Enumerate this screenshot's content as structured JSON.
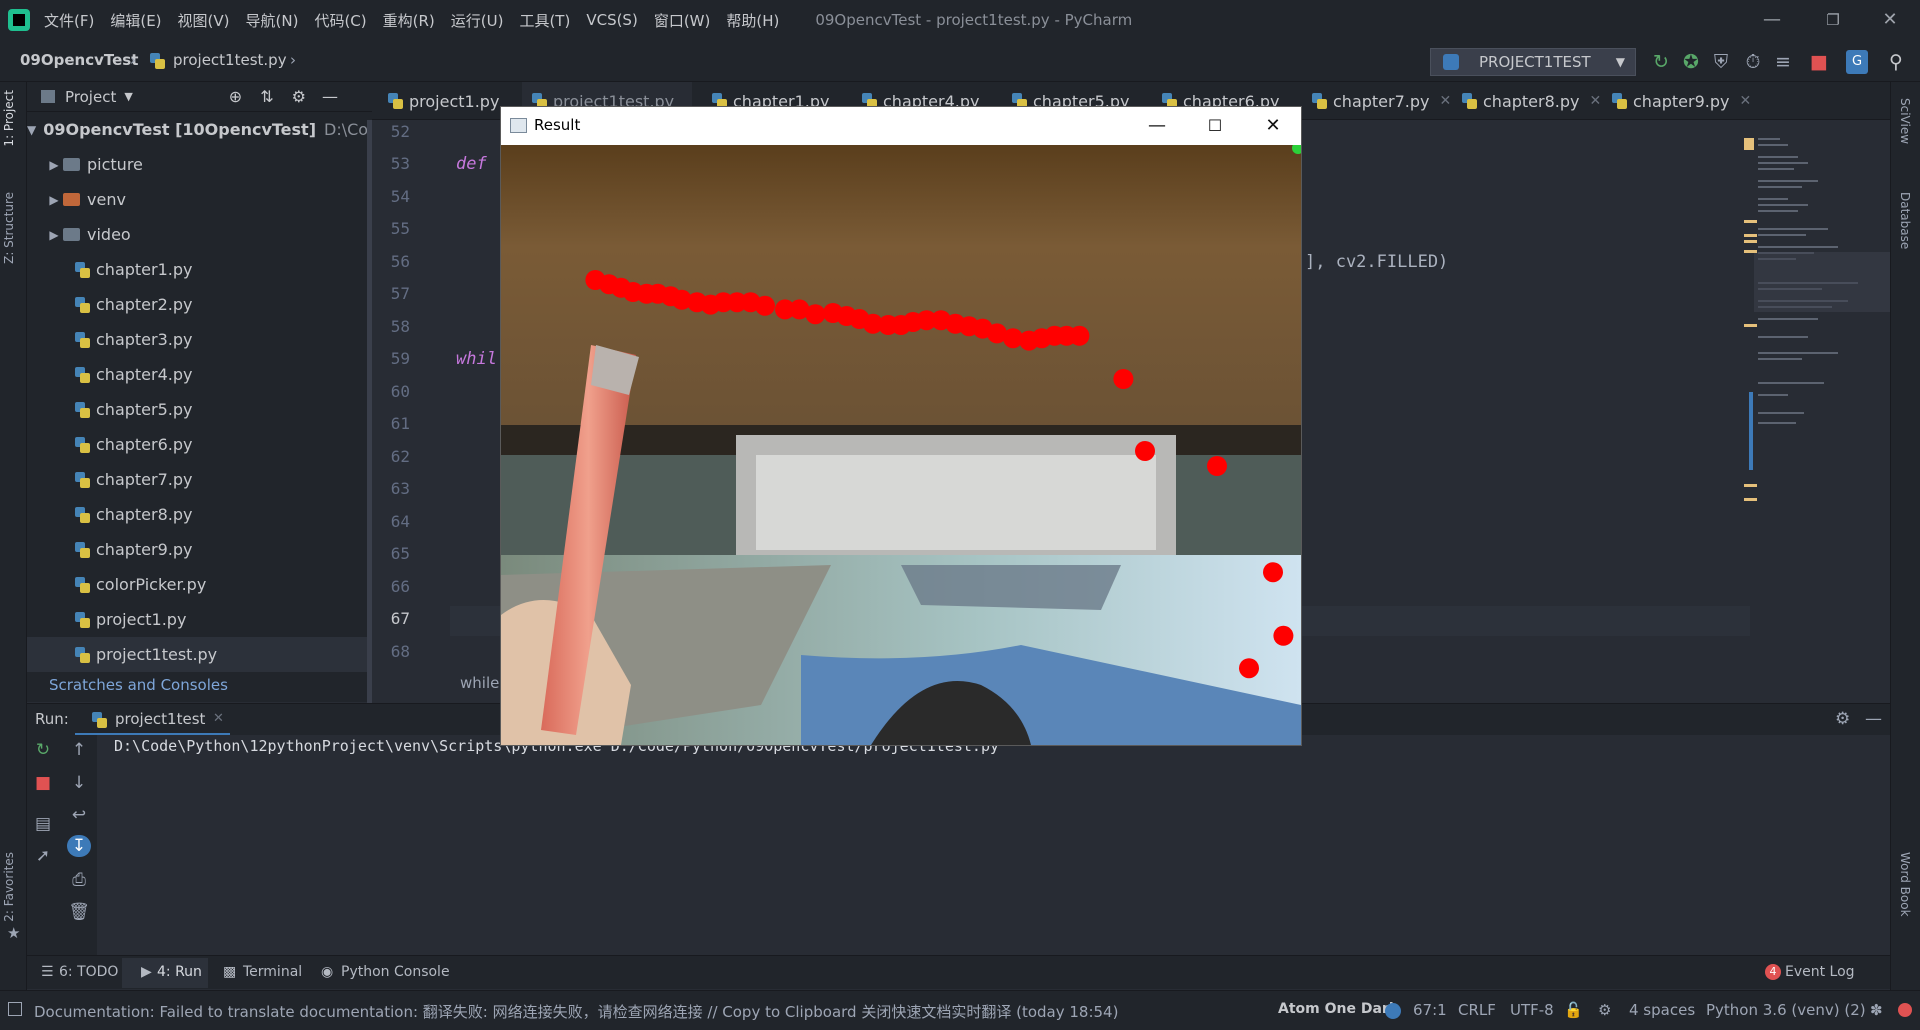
{
  "menubar": {
    "items": [
      "文件(F)",
      "编辑(E)",
      "视图(V)",
      "导航(N)",
      "代码(C)",
      "重构(R)",
      "运行(U)",
      "工具(T)",
      "VCS(S)",
      "窗口(W)",
      "帮助(H)"
    ],
    "window_title": "09OpencvTest - project1test.py - PyCharm"
  },
  "navbar": {
    "project": "09OpencvTest",
    "file": "project1test.py",
    "run_config": "PROJECT1TEST"
  },
  "left_strip": {
    "project_label": "1: Project",
    "structure_label": "Z: Structure",
    "favorites_label": "2: Favorites"
  },
  "right_strip": {
    "sciview_label": "SciView",
    "database_label": "Database",
    "wordbook_label": "Word Book"
  },
  "project_panel": {
    "title": "Project",
    "root": "09OpencvTest [10OpencvTest]",
    "root_path": "D:\\Code\\",
    "folders": [
      "picture",
      "venv",
      "video"
    ],
    "files": [
      "chapter1.py",
      "chapter2.py",
      "chapter3.py",
      "chapter4.py",
      "chapter5.py",
      "chapter6.py",
      "chapter7.py",
      "chapter8.py",
      "chapter9.py",
      "colorPicker.py",
      "project1.py",
      "project1test.py"
    ],
    "scratches": "Scratches and Consoles"
  },
  "tabs": [
    "project1.py",
    "project1test.py",
    "chapter1.py",
    "chapter4.py",
    "chapter5.py",
    "chapter6.py",
    "chapter7.py",
    "chapter8.py",
    "chapter9.py"
  ],
  "editor": {
    "line_numbers": [
      "52",
      "53",
      "54",
      "55",
      "56",
      "57",
      "58",
      "59",
      "60",
      "61",
      "62",
      "63",
      "64",
      "65",
      "66",
      "67",
      "68"
    ],
    "kw_def": "def",
    "kw_while": "whil",
    "code_fragment": "], cv2.FILLED)",
    "breadcrumb": "while"
  },
  "run_panel": {
    "label": "Run:",
    "tab": "project1test",
    "command": "D:\\Code\\Python\\12pythonProject\\venv\\Scripts\\python.exe D:/Code/Python/09OpencvTest/project1test.py"
  },
  "bottom_tabs": {
    "todo": "6: TODO",
    "run": "4: Run",
    "terminal": "Terminal",
    "python_console": "Python Console",
    "event_log": "Event Log",
    "event_count": "4"
  },
  "statusbar": {
    "message": "Documentation: Failed to translate documentation: 翻译失败: 网络连接失败，请检查网络连接 // Copy to Clipboard   关闭快速文档实时翻译 (today 18:54)",
    "theme": "Atom One Dark",
    "position": "67:1",
    "line_sep": "CRLF",
    "encoding": "UTF-8",
    "indent": "4 spaces",
    "interpreter": "Python 3.6 (venv) (2)"
  },
  "result_window": {
    "title": "Result"
  },
  "colors": {
    "accent": "#3d7ab8",
    "dot": "#ff0000",
    "keyword": "#c678dd"
  },
  "points": [
    {
      "x": 0.118,
      "y": 0.225
    },
    {
      "x": 0.135,
      "y": 0.232
    },
    {
      "x": 0.15,
      "y": 0.238
    },
    {
      "x": 0.165,
      "y": 0.245
    },
    {
      "x": 0.182,
      "y": 0.248
    },
    {
      "x": 0.196,
      "y": 0.248
    },
    {
      "x": 0.212,
      "y": 0.252
    },
    {
      "x": 0.226,
      "y": 0.258
    },
    {
      "x": 0.245,
      "y": 0.262
    },
    {
      "x": 0.262,
      "y": 0.266
    },
    {
      "x": 0.278,
      "y": 0.262
    },
    {
      "x": 0.295,
      "y": 0.262
    },
    {
      "x": 0.312,
      "y": 0.262
    },
    {
      "x": 0.33,
      "y": 0.268
    },
    {
      "x": 0.355,
      "y": 0.274
    },
    {
      "x": 0.373,
      "y": 0.274
    },
    {
      "x": 0.393,
      "y": 0.282
    },
    {
      "x": 0.415,
      "y": 0.28
    },
    {
      "x": 0.432,
      "y": 0.285
    },
    {
      "x": 0.448,
      "y": 0.29
    },
    {
      "x": 0.465,
      "y": 0.298
    },
    {
      "x": 0.484,
      "y": 0.3
    },
    {
      "x": 0.5,
      "y": 0.3
    },
    {
      "x": 0.515,
      "y": 0.295
    },
    {
      "x": 0.532,
      "y": 0.292
    },
    {
      "x": 0.55,
      "y": 0.292
    },
    {
      "x": 0.568,
      "y": 0.298
    },
    {
      "x": 0.585,
      "y": 0.302
    },
    {
      "x": 0.602,
      "y": 0.306
    },
    {
      "x": 0.62,
      "y": 0.314
    },
    {
      "x": 0.64,
      "y": 0.322
    },
    {
      "x": 0.66,
      "y": 0.326
    },
    {
      "x": 0.676,
      "y": 0.322
    },
    {
      "x": 0.692,
      "y": 0.318
    },
    {
      "x": 0.707,
      "y": 0.318
    },
    {
      "x": 0.723,
      "y": 0.318
    },
    {
      "x": 0.778,
      "y": 0.39
    },
    {
      "x": 0.805,
      "y": 0.51
    },
    {
      "x": 0.895,
      "y": 0.535
    },
    {
      "x": 0.965,
      "y": 0.712
    },
    {
      "x": 0.978,
      "y": 0.818
    },
    {
      "x": 0.935,
      "y": 0.872
    }
  ]
}
